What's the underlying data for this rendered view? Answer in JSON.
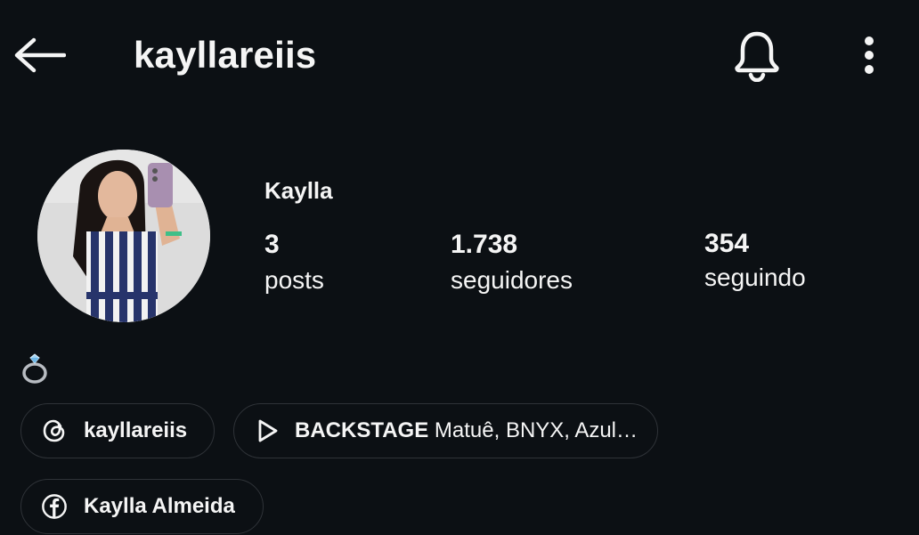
{
  "header": {
    "username": "kayllareiis",
    "back_icon": "arrow-left-icon",
    "notification_icon": "bell-icon",
    "more_icon": "more-vertical-icon"
  },
  "profile": {
    "display_name": "Kaylla",
    "avatar_icon": "profile-photo",
    "stats": {
      "posts": {
        "value": "3",
        "label": "posts"
      },
      "followers": {
        "value": "1.738",
        "label": "seguidores"
      },
      "following": {
        "value": "354",
        "label": "seguindo"
      }
    },
    "bio_emoji": "ring-emoji"
  },
  "links": {
    "threads": {
      "icon": "threads-icon",
      "label": "kayllareiis"
    },
    "reel": {
      "icon": "play-icon",
      "title": "BACKSTAGE",
      "subtitle": "Matuê, BNYX, Azul…"
    },
    "facebook": {
      "icon": "facebook-icon",
      "label": "Kaylla Almeida"
    }
  },
  "colors": {
    "background": "#0c1014",
    "text": "#f5f5f5",
    "chip_border": "#2f3338"
  }
}
